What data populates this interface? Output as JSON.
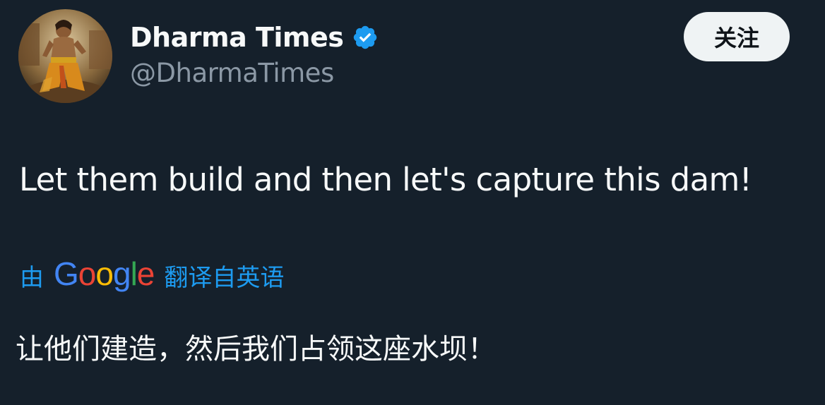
{
  "author": {
    "display_name": "Dharma Times",
    "handle": "@DharmaTimes",
    "verified": true
  },
  "follow_button": {
    "label": "关注"
  },
  "tweet": {
    "text": "Let them build and then let's capture this dam!"
  },
  "translation": {
    "prefix": "由",
    "provider": "Google",
    "suffix": "翻译自英语",
    "text": "让他们建造，然后我们占领这座水坝！"
  },
  "colors": {
    "background": "#15202b",
    "accent": "#1d9bf0",
    "secondary_text": "#8b98a5",
    "google_blue": "#4285f4",
    "google_red": "#ea4335",
    "google_yellow": "#fbbc05",
    "google_green": "#34a853"
  }
}
